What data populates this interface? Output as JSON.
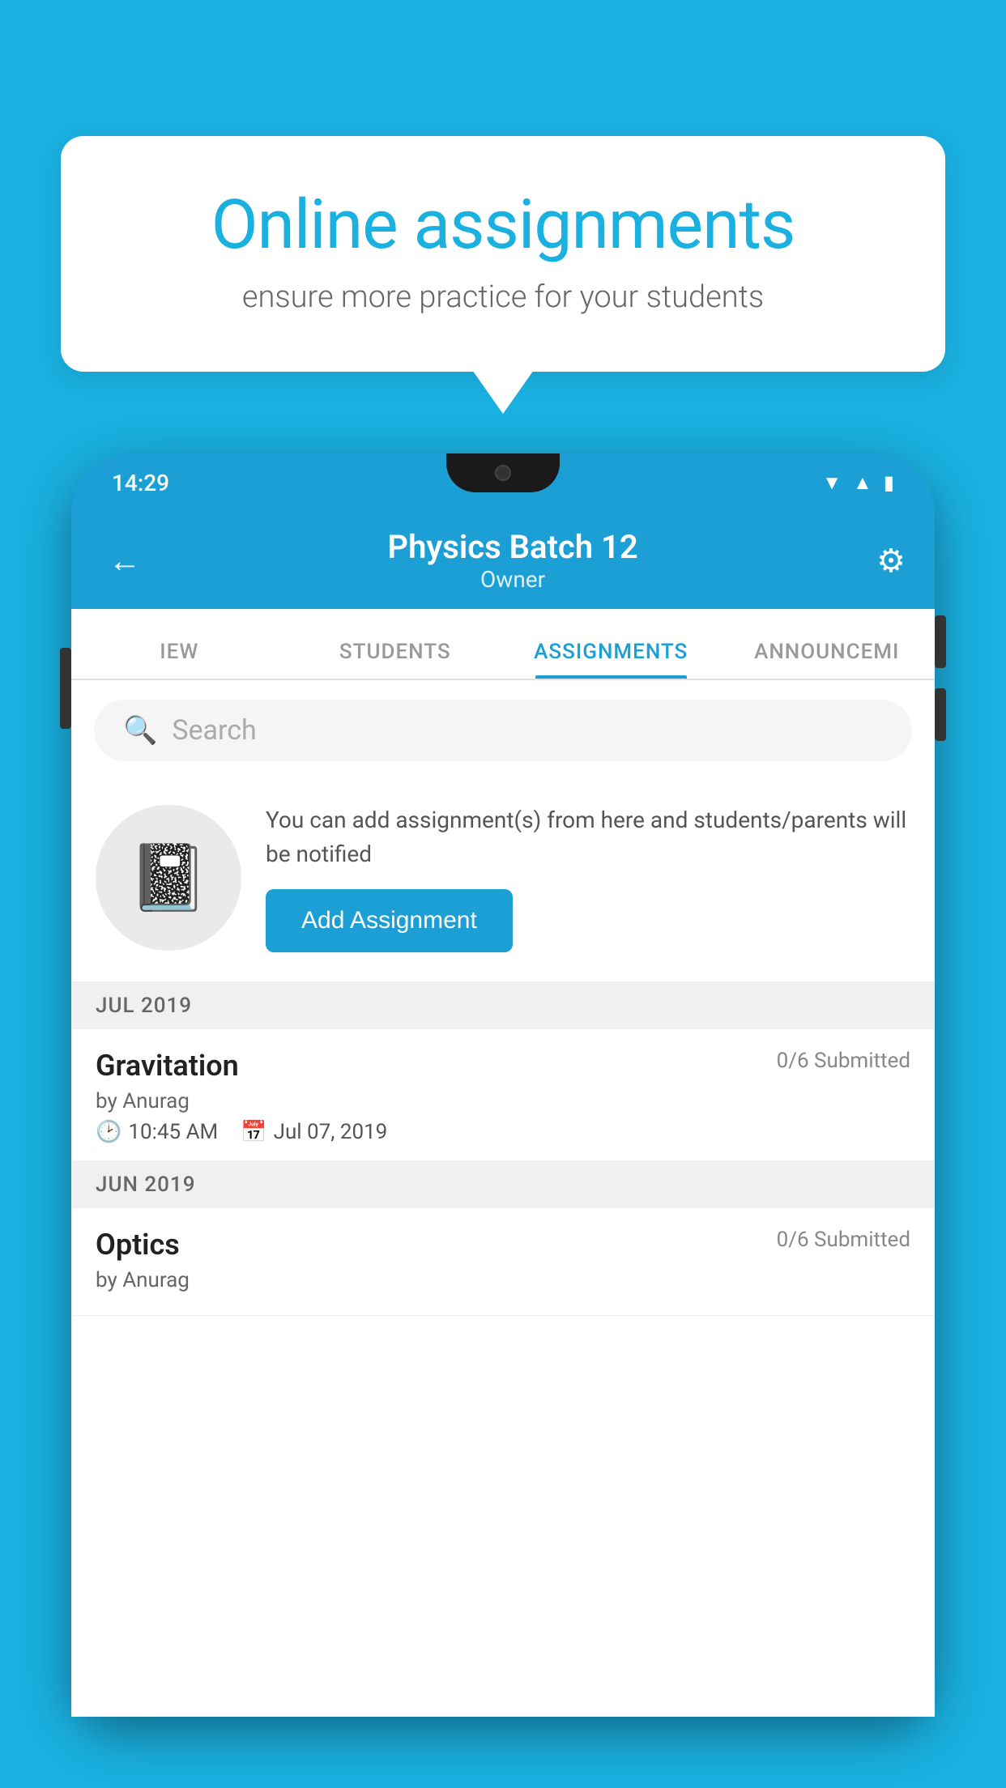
{
  "background": {
    "color": "#1ab0e0"
  },
  "speech_bubble": {
    "title": "Online assignments",
    "subtitle": "ensure more practice for your students"
  },
  "status_bar": {
    "time": "14:29",
    "icons": [
      "wifi",
      "signal",
      "battery"
    ]
  },
  "header": {
    "title": "Physics Batch 12",
    "subtitle": "Owner",
    "back_label": "←",
    "gear_label": "⚙"
  },
  "tabs": [
    {
      "label": "IEW",
      "active": false
    },
    {
      "label": "STUDENTS",
      "active": false
    },
    {
      "label": "ASSIGNMENTS",
      "active": true
    },
    {
      "label": "ANNOUNCEMI",
      "active": false
    }
  ],
  "search": {
    "placeholder": "Search"
  },
  "add_section": {
    "description": "You can add assignment(s) from here and students/parents will be notified",
    "button_label": "Add Assignment"
  },
  "sections": [
    {
      "month": "JUL 2019",
      "assignments": [
        {
          "name": "Gravitation",
          "submitted": "0/6 Submitted",
          "by": "by Anurag",
          "time": "10:45 AM",
          "date": "Jul 07, 2019"
        }
      ]
    },
    {
      "month": "JUN 2019",
      "assignments": [
        {
          "name": "Optics",
          "submitted": "0/6 Submitted",
          "by": "by Anurag",
          "time": "",
          "date": ""
        }
      ]
    }
  ]
}
